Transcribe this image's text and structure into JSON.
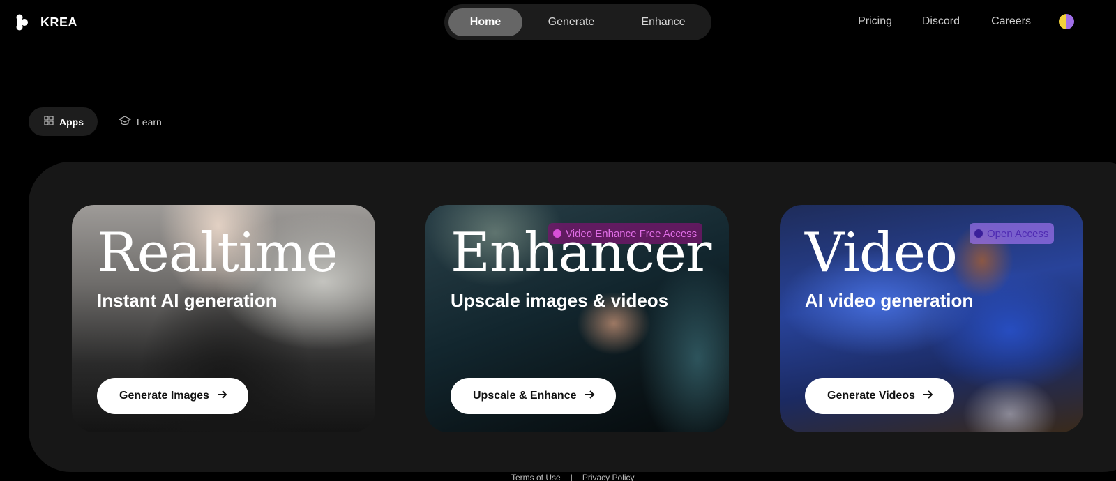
{
  "header": {
    "brand": "KREA",
    "logo_icon": "krea-logo-icon",
    "tabs": [
      {
        "label": "Home",
        "active": true
      },
      {
        "label": "Generate",
        "active": false
      },
      {
        "label": "Enhance",
        "active": false
      }
    ],
    "links": [
      "Pricing",
      "Discord",
      "Careers"
    ],
    "avatar_colors": [
      "#f2d13a",
      "#a06ee8"
    ]
  },
  "subnav": {
    "items": [
      {
        "label": "Apps",
        "icon": "grid-icon",
        "active": true
      },
      {
        "label": "Learn",
        "icon": "graduation-cap-icon",
        "active": false
      }
    ]
  },
  "cards": [
    {
      "title": "Realtime",
      "subtitle": "Instant AI generation",
      "cta": "Generate Images",
      "badge": ""
    },
    {
      "title": "Enhancer",
      "subtitle": "Upscale images & videos",
      "cta": "Upscale & Enhance",
      "badge": "Video Enhance Free Access"
    },
    {
      "title": "Video",
      "subtitle": "AI video generation",
      "cta": "Generate Videos",
      "badge": "Open Access"
    }
  ],
  "footer": {
    "terms": "Terms of Use",
    "separator": "|",
    "privacy": "Privacy Policy"
  },
  "colors": {
    "background": "#000000",
    "panel": "#171717",
    "enhancer_badge": "#e06ee6",
    "video_badge": "#4f2bb3"
  }
}
